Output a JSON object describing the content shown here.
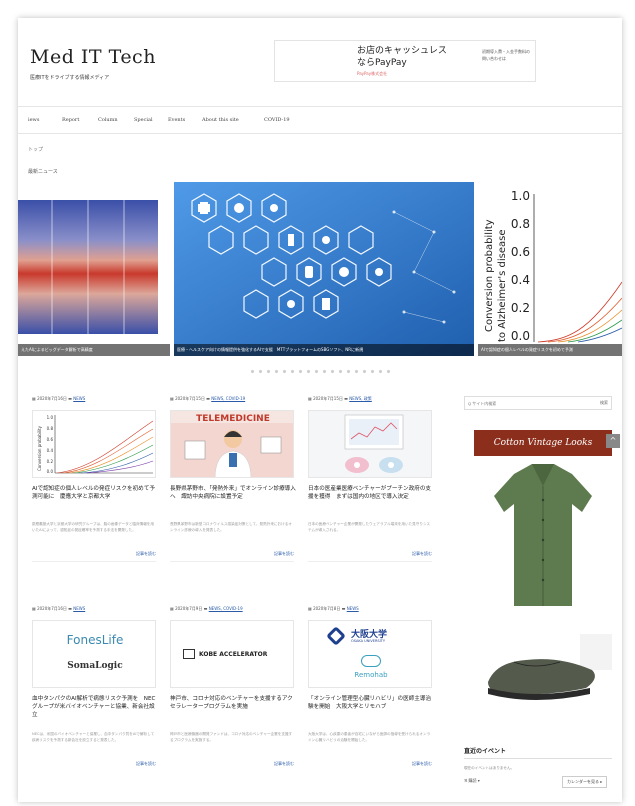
{
  "header": {
    "site_title": "Med IT Tech",
    "tagline": "医療ITをドライブする情報メディア",
    "ad": {
      "headline": "お店のキャッシュレス",
      "brand_line": "ならPayPay",
      "small": "PayPay株式会社",
      "side": "初期導入費・入金手数料の問い合わせは"
    }
  },
  "nav": [
    "iews",
    "Report",
    "Column",
    "Special",
    "Events",
    "About this site",
    "COVID-19"
  ],
  "breadcrumb": "トップ",
  "section_label": "最新ニュース",
  "slides": [
    {
      "caption": "えたAIによるビッグデータ解析で高精度"
    },
    {
      "caption": "医療・ヘルスケア向けの情報提供を強化するAIで支援　MTTプラットフォームのSBGソフト、NRに新規"
    },
    {
      "caption": "AIで認知症の個人レベルの発症リスクを初めて予測"
    }
  ],
  "slide_chart": {
    "ylabel": "Conversion probability\nto Alzheimer's disease",
    "ticks": [
      "1.0",
      "0.8",
      "0.6",
      "0.4",
      "0.2",
      "0.0"
    ]
  },
  "cards": [
    {
      "date": "2020年7月16日",
      "category": "NEWS",
      "title": "AIで認知症の個人レベルの発症リスクを初めて予測可能に　慶應大学と京都大学",
      "excerpt": "慶應義塾大学と京都大学の研究グループは、脳の画像データと臨床情報を用いたAIによって、認知症の発症確率を予測する手法を開発した。",
      "more": "記事を読む"
    },
    {
      "date": "2020年7月15日",
      "category": "NEWS, COVID-19",
      "title": "長野県茅野市、「発熱外来」でオンライン診療導入へ　諏訪中央病院に設置予定",
      "excerpt": "長野県茅野市は新型コロナウイルス感染症対策として、発熱外来におけるオンライン診療の導入を発表した。",
      "more": "記事を読む"
    },
    {
      "date": "2020年7月15日",
      "category": "NEWS, 政策",
      "title": "日本の医産業医療ベンチャーがプーチン政府の支援を獲得　まずは国内の地区で導入決定",
      "excerpt": "日本の医療ベンチャー企業が開発したウェアラブル端末を用いた見守りシステムが導入される。",
      "more": "記事を読む"
    },
    {
      "date": "2020年7月16日",
      "category": "NEWS",
      "title": "血中タンパクのAI解析で病態リスク予測を　NECグループが米バイオベンチャーと協業、新会社設立",
      "excerpt": "NECは、米国のバイオベンチャーと協業し、血中タンパク質をAIで解析して疾病リスクを予測する新会社を設立すると発表した。",
      "more": "記事を読む",
      "logo_top": "FonesLife",
      "logo_bottom": "SomaLogic"
    },
    {
      "date": "2020年7月9日",
      "category": "NEWS, COVID-19",
      "title": "神戸市、コロナ対応のベンチャーを支援するアクセラレータープログラムを実施",
      "excerpt": "神戸市と医療機器の開発ファンドは、コロナ対応のベンチャー企業を支援するプログラムを実施する。",
      "more": "記事を読む",
      "logo_top": "KOBE ACCELERATOR"
    },
    {
      "date": "2020年7月8日",
      "category": "NEWS",
      "title": "「オンライン管理型心臓リハビリ」の医師主導治験を開始　大阪大学とリモハブ",
      "excerpt": "大阪大学は、心疾患の患者が自宅にいながら医師の指導を受けられるオンライン心臓リハビリの治験を開始した。",
      "more": "記事を読む",
      "logo_top": "大阪大学",
      "logo_sub": "OSAKA UNIVERSITY",
      "logo_bottom": "Remohab"
    }
  ],
  "sidebar": {
    "search_placeholder": "Q サイト内検索",
    "search_button": "検索",
    "ad_banner": "Cotton Vintage Looks",
    "events_title": "直近のイベント",
    "events_empty": "現在のイベントはありません。",
    "rss": "ℜ 購読 ▾",
    "calendar": "カレンダーを見る ▸"
  },
  "colors": {
    "accent_link": "#2a5aa8",
    "banner": "#8b2e1b",
    "slide_blue": "#2f7fd4"
  }
}
